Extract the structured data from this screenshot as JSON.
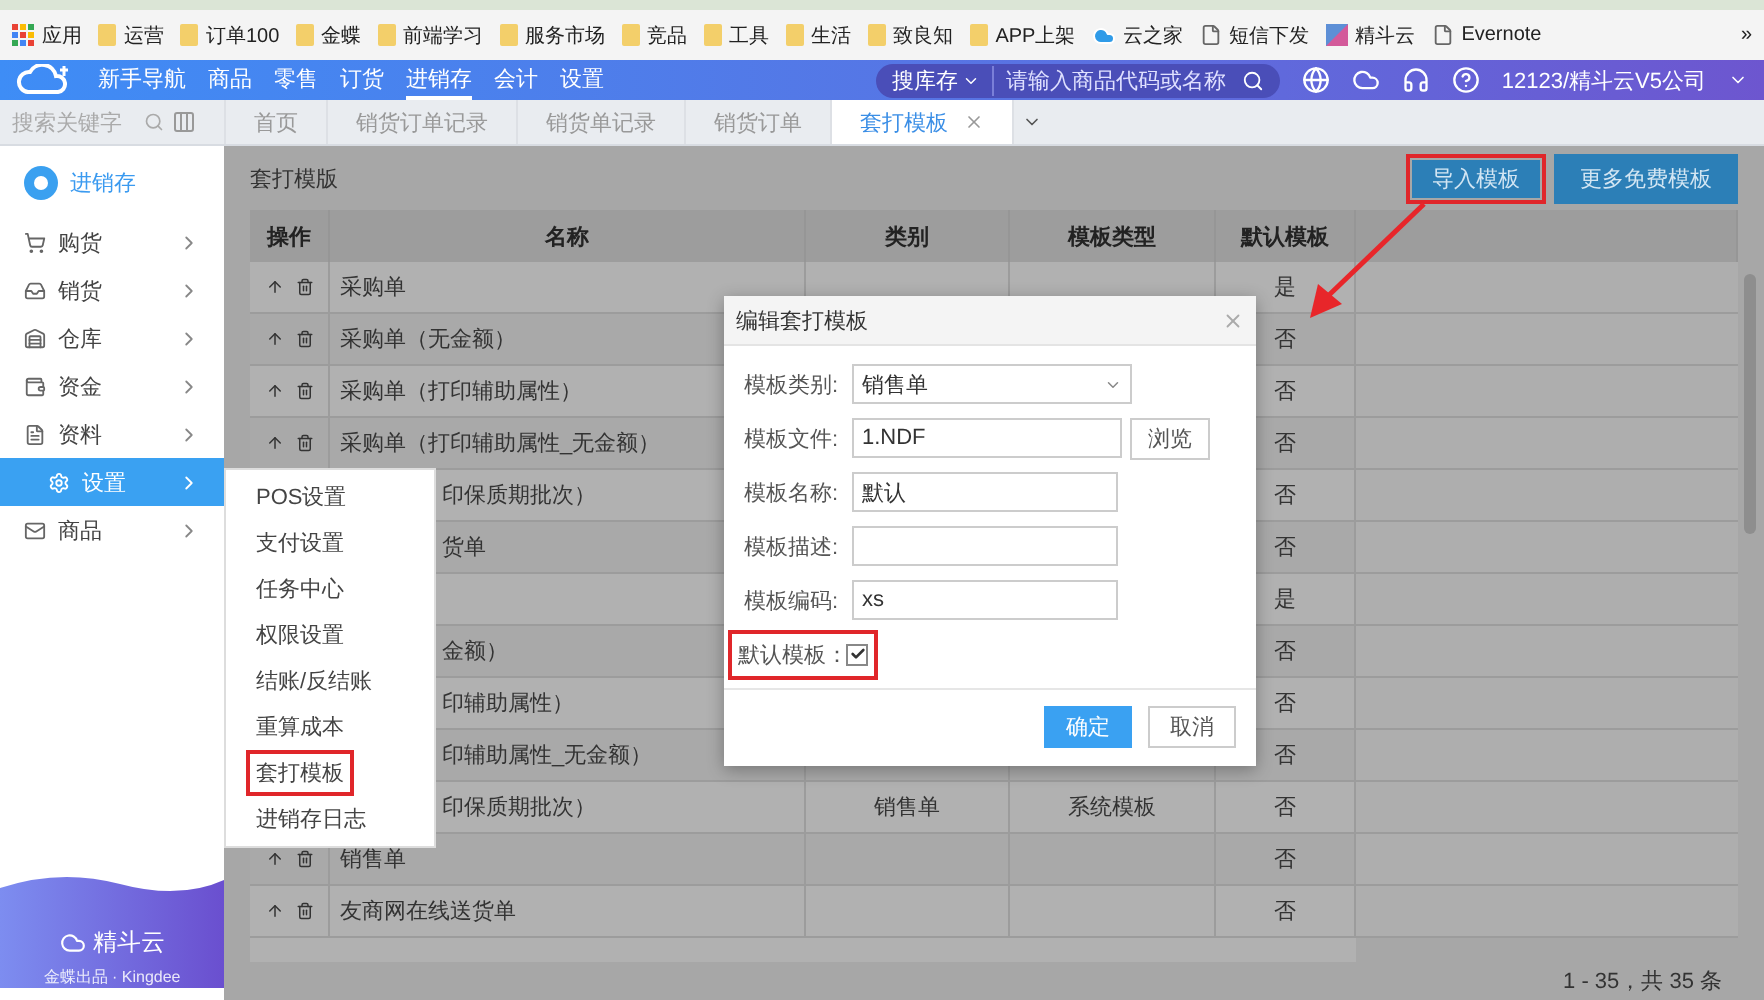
{
  "bookmarks": {
    "apps_label": "应用",
    "items": [
      {
        "label": "运营",
        "kind": "folder"
      },
      {
        "label": "订单100",
        "kind": "folder"
      },
      {
        "label": "金蝶",
        "kind": "folder"
      },
      {
        "label": "前端学习",
        "kind": "folder"
      },
      {
        "label": "服务市场",
        "kind": "folder"
      },
      {
        "label": "竞品",
        "kind": "folder"
      },
      {
        "label": "工具",
        "kind": "folder"
      },
      {
        "label": "生活",
        "kind": "folder"
      },
      {
        "label": "致良知",
        "kind": "folder"
      },
      {
        "label": "APP上架",
        "kind": "folder"
      },
      {
        "label": "云之家",
        "kind": "cloud"
      },
      {
        "label": "短信下发",
        "kind": "page"
      },
      {
        "label": "精斗云",
        "kind": "app"
      },
      {
        "label": "Evernote",
        "kind": "page"
      }
    ],
    "more": "»"
  },
  "top_nav": {
    "items": [
      {
        "label": "新手导航",
        "selected": false
      },
      {
        "label": "商品",
        "selected": false
      },
      {
        "label": "零售",
        "selected": false
      },
      {
        "label": "订货",
        "selected": false
      },
      {
        "label": "进销存",
        "selected": true
      },
      {
        "label": "会计",
        "selected": false
      },
      {
        "label": "设置",
        "selected": false
      }
    ],
    "search_scope": "搜库存",
    "search_placeholder": "请输入商品代码或名称",
    "account": "12123/精斗云V5公司"
  },
  "tab_bar": {
    "search_placeholder": "搜索关键字",
    "tabs": [
      {
        "label": "首页",
        "selected": false
      },
      {
        "label": "销货订单记录",
        "selected": false
      },
      {
        "label": "销货单记录",
        "selected": false
      },
      {
        "label": "销货订单",
        "selected": false
      },
      {
        "label": "套打模板",
        "selected": true
      }
    ]
  },
  "sidebar": {
    "title": "进销存",
    "items": [
      {
        "label": "购货",
        "selected": false
      },
      {
        "label": "销货",
        "selected": false
      },
      {
        "label": "仓库",
        "selected": false
      },
      {
        "label": "资金",
        "selected": false
      },
      {
        "label": "资料",
        "selected": false
      },
      {
        "label": "设置",
        "selected": true
      },
      {
        "label": "商品",
        "selected": false
      }
    ],
    "brand": "精斗云",
    "brand_sub": "金蝶出品 · Kingdee"
  },
  "submenu": {
    "items": [
      {
        "label": "POS设置",
        "highlighted": false
      },
      {
        "label": "支付设置",
        "highlighted": false
      },
      {
        "label": "任务中心",
        "highlighted": false
      },
      {
        "label": "权限设置",
        "highlighted": false
      },
      {
        "label": "结账/反结账",
        "highlighted": false
      },
      {
        "label": "重算成本",
        "highlighted": false
      },
      {
        "label": "套打模板",
        "highlighted": true
      },
      {
        "label": "进销存日志",
        "highlighted": false
      }
    ]
  },
  "page": {
    "title": "套打模版",
    "buttons": [
      {
        "label": "导入模板",
        "highlighted": true
      },
      {
        "label": "更多免费模板",
        "highlighted": false
      }
    ]
  },
  "table": {
    "columns": [
      "操作",
      "名称",
      "类别",
      "模板类型",
      "默认模板"
    ],
    "rows": [
      {
        "name": "采购单",
        "covered": false,
        "default": "是"
      },
      {
        "name": "采购单（无金额）",
        "covered": false,
        "default": "否"
      },
      {
        "name": "采购单（打印辅助属性）",
        "covered": false,
        "default": "否"
      },
      {
        "name": "采购单（打印辅助属性_无金额）",
        "covered": false,
        "default": "否"
      },
      {
        "name": "印保质期批次）",
        "covered": true,
        "default": "否"
      },
      {
        "name": "货单",
        "covered": true,
        "default": "否"
      },
      {
        "default": "是"
      },
      {
        "name": "金额）",
        "covered": true,
        "default": "否"
      },
      {
        "name": "印辅助属性）",
        "covered": true,
        "default": "否"
      },
      {
        "name": "印辅助属性_无金额）",
        "covered": true,
        "default": "否"
      },
      {
        "name": "印保质期批次）",
        "covered": true,
        "category": "销售单",
        "type": "系统模板",
        "default": "否"
      },
      {
        "name": "销售单",
        "covered": false,
        "default": "否"
      },
      {
        "name": "友商网在线送货单",
        "covered": false,
        "default": "否"
      }
    ],
    "pagination": "1 - 35，共 35 条"
  },
  "dialog": {
    "title": "编辑套打模板",
    "fields": [
      {
        "label": "模板类别:",
        "kind": "select",
        "value": "销售单"
      },
      {
        "label": "模板文件:",
        "kind": "file",
        "value": "1.NDF",
        "button": "浏览"
      },
      {
        "label": "模板名称:",
        "kind": "text",
        "value": "默认"
      },
      {
        "label": "模板描述:",
        "kind": "text"
      },
      {
        "label": "模板编码:",
        "kind": "text",
        "value": "xs"
      },
      {
        "label": "默认模板：",
        "kind": "checkbox",
        "checked": true,
        "highlighted": true
      }
    ],
    "buttons": [
      {
        "label": "确定",
        "primary": true
      },
      {
        "label": "取消",
        "primary": false
      }
    ]
  }
}
